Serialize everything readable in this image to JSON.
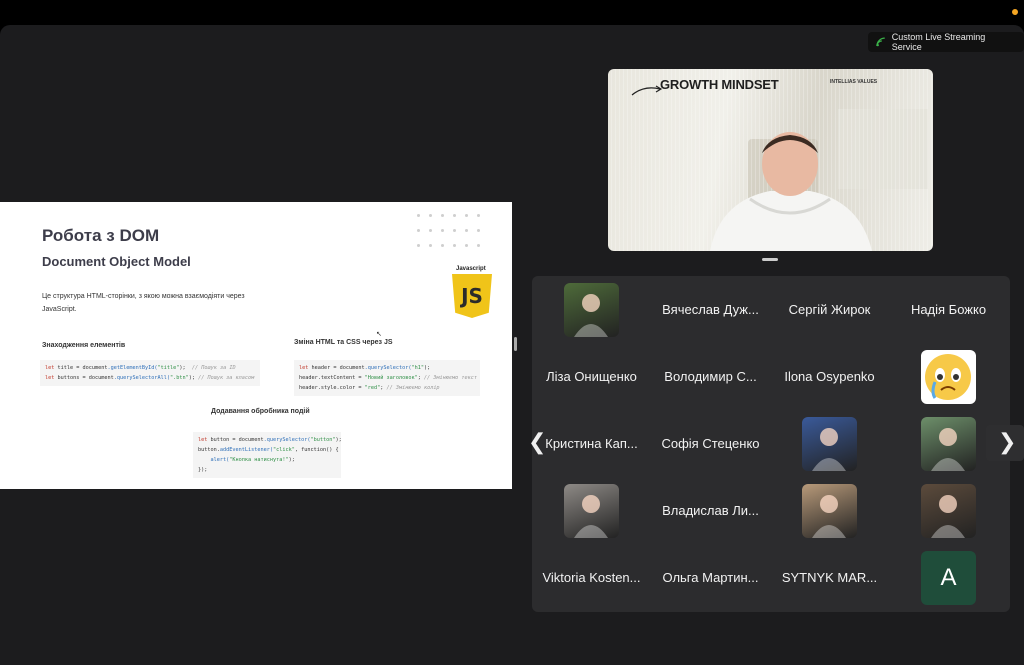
{
  "stream_badge": {
    "label": "Custom Live Streaming Service",
    "icon": "broadcast-icon",
    "accent": "#3bb34a"
  },
  "slide": {
    "title": "Робота з DOM",
    "subtitle": "Document Object Model",
    "description": "Це структура HTML-сторінки, з якою можна взаємодіяти через JavaScript.",
    "js_label": "Javascript",
    "js_logo": "JS",
    "section_find": "Знаходження елементів",
    "section_change": "Зміна HTML та CSS через JS",
    "section_add": "Додавання обробника подій",
    "code_find": [
      {
        "kw": "let",
        "rest": " title = ",
        "obj": "document",
        "fn": ".getElementById(",
        "str": "\"title\"",
        "end": ");",
        "comment": "  // Пошук за ID"
      },
      {
        "kw": "let",
        "rest": " buttons = ",
        "obj": "document",
        "fn": ".querySelectorAll(",
        "str": "\".btn\"",
        "end": ");",
        "comment": " // Пошук за класом"
      }
    ],
    "code_change": [
      {
        "kw": "let",
        "rest": " header = ",
        "obj": "document",
        "fn": ".querySelector(",
        "str": "\"h1\"",
        "end": ");",
        "comment": ""
      },
      {
        "kw": "",
        "rest": "header.textContent = ",
        "obj": "",
        "fn": "",
        "str": "\"Новий заголовок\"",
        "end": ";",
        "comment": " // Змінюємо текст"
      },
      {
        "kw": "",
        "rest": "header.style.color = ",
        "obj": "",
        "fn": "",
        "str": "\"red\"",
        "end": ";",
        "comment": " // Змінюємо колір"
      }
    ],
    "code_add": [
      {
        "kw": "let",
        "rest": " button = ",
        "obj": "document",
        "fn": ".querySelector(",
        "str": "\"button\"",
        "end": ");",
        "comment": ""
      },
      {
        "kw": "",
        "rest": "button.",
        "obj": "",
        "fn": "addEventListener(",
        "str": "\"click\"",
        "end": ", function() {",
        "comment": ""
      },
      {
        "kw": "",
        "rest": "    ",
        "obj": "",
        "fn": "alert(",
        "str": "\"Кнопка натиснута!\"",
        "end": ");",
        "comment": ""
      },
      {
        "kw": "",
        "rest": "});",
        "obj": "",
        "fn": "",
        "str": "",
        "end": "",
        "comment": ""
      }
    ]
  },
  "speaker": {
    "banner_title": "GROWTH MINDSET",
    "banner_brand": "INTELLIAS VALUES"
  },
  "participants": [
    {
      "type": "photo",
      "name": "participant-photo-1",
      "color": "#4e6b3a"
    },
    {
      "type": "name",
      "label": "Вячеслав Дуж..."
    },
    {
      "type": "name",
      "label": "Сергій Жирок"
    },
    {
      "type": "name",
      "label": "Надія Божко"
    },
    {
      "type": "name",
      "label": "Ліза Онищенко"
    },
    {
      "type": "name",
      "label": "Володимир С..."
    },
    {
      "type": "name",
      "label": "Ilona Osypenko"
    },
    {
      "type": "emoji",
      "name": "crying-emoji-avatar",
      "color": "#f7c948"
    },
    {
      "type": "name",
      "label": "Кристина Кап..."
    },
    {
      "type": "name",
      "label": "Софія Стеценко"
    },
    {
      "type": "photo",
      "name": "city-night-avatar",
      "color": "#3a5a9a"
    },
    {
      "type": "photo",
      "name": "participant-photo-2",
      "color": "#6d8f6a"
    },
    {
      "type": "photo",
      "name": "participant-photo-3",
      "color": "#8e8a86"
    },
    {
      "type": "name",
      "label": "Владислав Ли..."
    },
    {
      "type": "photo",
      "name": "participant-photo-4",
      "color": "#b89a7a"
    },
    {
      "type": "photo",
      "name": "participant-photo-5",
      "color": "#5c4b3c"
    },
    {
      "type": "name",
      "label": "Viktoria Kosten..."
    },
    {
      "type": "name",
      "label": "Ольга Мартин..."
    },
    {
      "type": "name",
      "label": "SYTNYK MAR..."
    },
    {
      "type": "letter",
      "label": "A",
      "color": "#1f4d3a"
    }
  ],
  "nav": {
    "prev": "❮",
    "next": "❯"
  }
}
